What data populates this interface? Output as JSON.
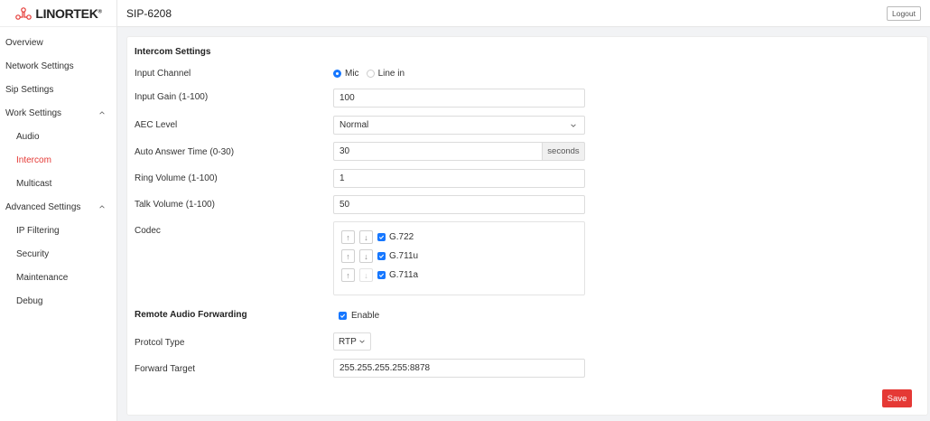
{
  "brand": {
    "logo_text": "LINORTEK",
    "accent": "#e53935"
  },
  "header": {
    "device_name": "SIP-6208",
    "logout_label": "Logout"
  },
  "sidebar": {
    "items": [
      {
        "label": "Overview"
      },
      {
        "label": "Network Settings"
      },
      {
        "label": "Sip Settings"
      },
      {
        "label": "Work Settings"
      },
      {
        "label": "Audio"
      },
      {
        "label": "Intercom"
      },
      {
        "label": "Multicast"
      },
      {
        "label": "Advanced Settings"
      },
      {
        "label": "IP Filtering"
      },
      {
        "label": "Security"
      },
      {
        "label": "Maintenance"
      },
      {
        "label": "Debug"
      }
    ]
  },
  "form": {
    "intercom_title": "Intercom Settings",
    "input_channel": {
      "label": "Input Channel",
      "options": [
        "Mic",
        "Line in"
      ],
      "selected": "Mic"
    },
    "input_gain": {
      "label": "Input Gain (1-100)",
      "value": "100"
    },
    "aec_level": {
      "label": "AEC Level",
      "value": "Normal"
    },
    "auto_answer": {
      "label": "Auto Answer Time (0-30)",
      "value": "30",
      "unit": "seconds"
    },
    "ring_volume": {
      "label": "Ring Volume (1-100)",
      "value": "1"
    },
    "talk_volume": {
      "label": "Talk Volume (1-100)",
      "value": "50"
    },
    "codec": {
      "label": "Codec",
      "items": [
        {
          "name": "G.722",
          "checked": true
        },
        {
          "name": "G.711u",
          "checked": true
        },
        {
          "name": "G.711a",
          "checked": true
        }
      ]
    },
    "remote_title": "Remote Audio Forwarding",
    "enable_label": "Enable",
    "protocol": {
      "label": "Protcol Type",
      "value": "RTP"
    },
    "forward_target": {
      "label": "Forward Target",
      "value": "255.255.255.255:8878"
    },
    "save_label": "Save"
  }
}
